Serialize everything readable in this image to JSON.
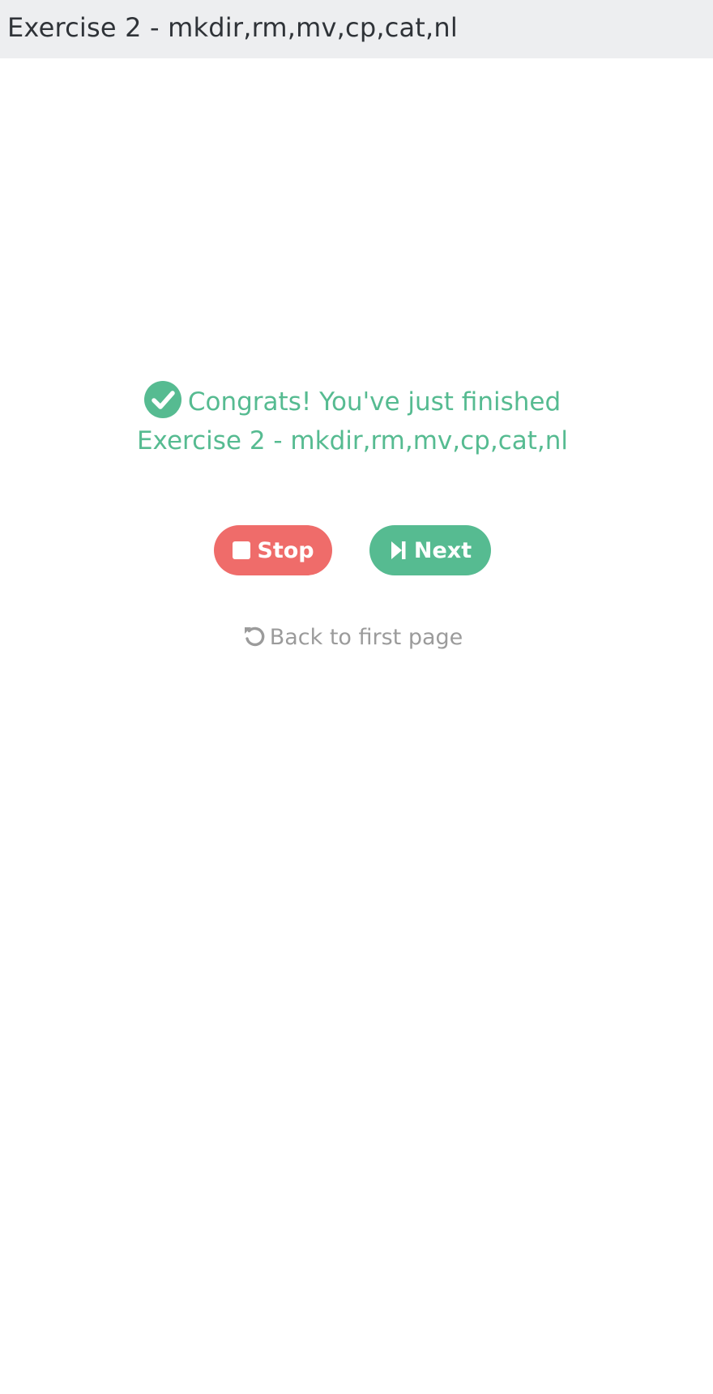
{
  "header": {
    "title": "Exercise 2 - mkdir,rm,mv,cp,cat,nl"
  },
  "congrats": {
    "icon": "check-circle-icon",
    "line1": "Congrats! You've just finished",
    "line2": "Exercise 2 - mkdir,rm,mv,cp,cat,nl"
  },
  "buttons": {
    "stop": {
      "label": "Stop",
      "icon": "stop-icon"
    },
    "next": {
      "label": "Next",
      "icon": "step-forward-icon"
    }
  },
  "back_link": {
    "label": "Back to first page",
    "icon": "undo-icon"
  },
  "colors": {
    "accent": "#56bb91",
    "danger": "#ef6c6a",
    "muted": "#9b9b9b",
    "header_bg": "#edeef0"
  }
}
